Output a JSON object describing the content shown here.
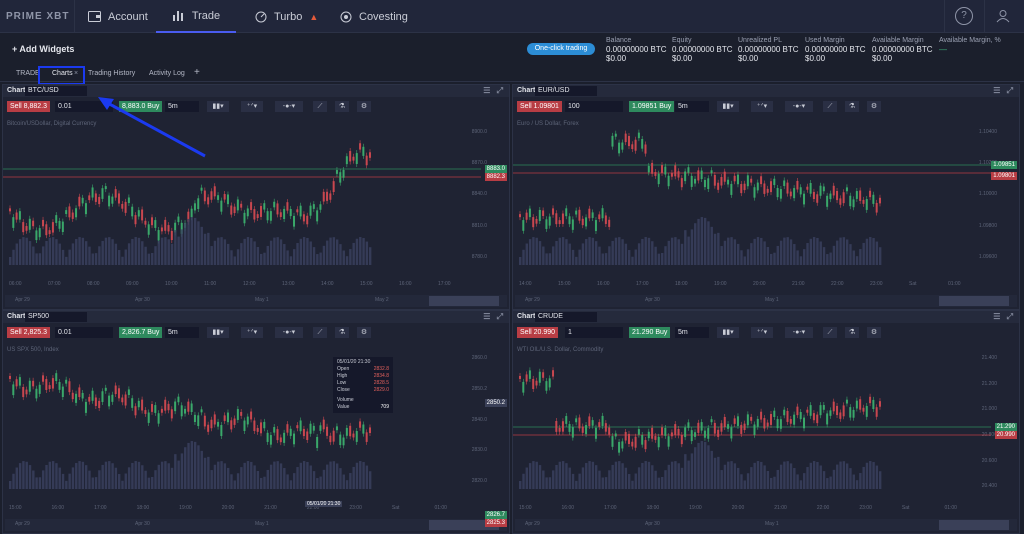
{
  "nav": {
    "logo": "PRIME XBT",
    "account": "Account",
    "trade": "Trade",
    "turbo": "Turbo",
    "covesting": "Covesting",
    "help": "?"
  },
  "header": {
    "add_widgets": "+ Add Widgets",
    "one_click": "One-click trading",
    "stats": [
      {
        "label": "Balance",
        "v1": "0.00000000 BTC",
        "v2": "$0.00"
      },
      {
        "label": "Equity",
        "v1": "0.00000000 BTC",
        "v2": "$0.00"
      },
      {
        "label": "Unrealized PL",
        "v1": "0.00000000 BTC",
        "v2": "$0.00"
      },
      {
        "label": "Used Margin",
        "v1": "0.00000000 BTC",
        "v2": "$0.00"
      },
      {
        "label": "Available Margin",
        "v1": "0.00000000 BTC",
        "v2": "$0.00"
      },
      {
        "label": "Available Margin, %",
        "v1": "—",
        "v2": ""
      }
    ]
  },
  "tabs": [
    "TRADE",
    "Charts",
    "Trading History",
    "Activity Log",
    "+"
  ],
  "panels": [
    {
      "title": "Chart",
      "symbol": "BTC/USD",
      "sell": "Sell 8,882.3",
      "qty": "0.01",
      "buy": "8,883.0 Buy",
      "tf": "5m",
      "desc": "Bitcoin/USDollar, Digital Currency",
      "p1": "8883.0",
      "p2": "8882.3",
      "y": [
        "8900.0",
        "8870.0",
        "8840.0",
        "8810.0",
        "8780.0"
      ],
      "x": [
        "06:00",
        "07:00",
        "08:00",
        "09:00",
        "10:00",
        "11:00",
        "12:00",
        "13:00",
        "14:00",
        "15:00",
        "16:00",
        "17:00"
      ],
      "d": [
        "Apr 29",
        "Apr 30",
        "May 1",
        "May 2"
      ]
    },
    {
      "title": "Chart",
      "symbol": "EUR/USD",
      "sell": "Sell 1.09801",
      "qty": "100",
      "buy": "1.09851 Buy",
      "tf": "5m",
      "desc": "Euro / US Dollar, Forex",
      "p1": "1.09851",
      "p2": "1.09801",
      "y": [
        "1.10400",
        "1.10200",
        "1.10000",
        "1.09800",
        "1.09600"
      ],
      "x": [
        "14:00",
        "15:00",
        "16:00",
        "17:00",
        "18:00",
        "19:00",
        "20:00",
        "21:00",
        "22:00",
        "23:00",
        "Sat",
        "01:00"
      ],
      "d": [
        "Apr 29",
        "Apr 30",
        "May 1"
      ]
    },
    {
      "title": "Chart",
      "symbol": "SP500",
      "sell": "Sell 2,825.3",
      "qty": "0.01",
      "buy": "2,826.7 Buy",
      "tf": "5m",
      "desc": "US SPX 500, Index",
      "p1": "2826.7",
      "p2": "2825.3",
      "y": [
        "2860.0",
        "2850.2",
        "2840.0",
        "2830.0",
        "2820.0"
      ],
      "x": [
        "15:00",
        "16:00",
        "17:00",
        "18:00",
        "19:00",
        "20:00",
        "21:00",
        "22:00",
        "23:00",
        "Sat",
        "01:00"
      ],
      "d": [
        "Apr 29",
        "Apr 30",
        "May 1"
      ],
      "tip": {
        "date": "05/01/20 21:30",
        "open": "2832.8",
        "high": "2834.8",
        "low": "2828.5",
        "close": "2829.0",
        "volume": "Volume",
        "value": "709",
        "vlabel": "Value"
      },
      "xsel": "05/01/20 21:30",
      "ysel": "2850.2"
    },
    {
      "title": "Chart",
      "symbol": "CRUDE",
      "sell": "Sell 20.990",
      "qty": "1",
      "buy": "21.290 Buy",
      "tf": "5m",
      "desc": "WTI OIL/U.S. Dollar, Commodity",
      "p1": "21.290",
      "p2": "20.990",
      "y": [
        "21.400",
        "21.200",
        "21.000",
        "20.800",
        "20.600",
        "20.400"
      ],
      "x": [
        "15:00",
        "16:00",
        "17:00",
        "18:00",
        "19:00",
        "20:00",
        "21:00",
        "22:00",
        "23:00",
        "Sat",
        "01:00"
      ],
      "d": [
        "Apr 29",
        "Apr 30",
        "May 1"
      ]
    }
  ],
  "labels": {
    "open": "Open",
    "high": "High",
    "low": "Low",
    "close": "Close"
  }
}
